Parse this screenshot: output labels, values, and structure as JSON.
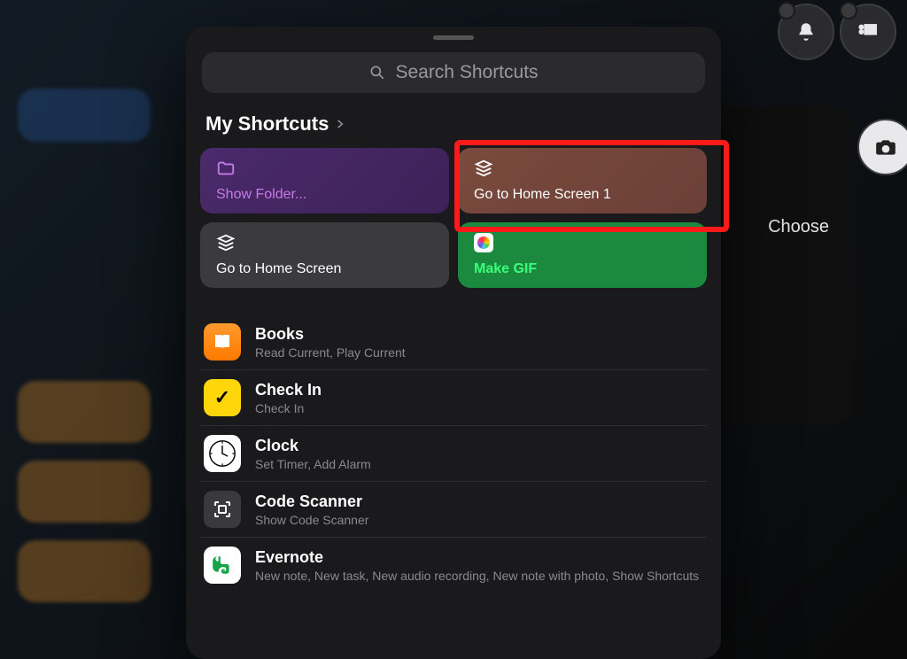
{
  "back_card": {
    "choose_label": "Choose"
  },
  "bubbles": {
    "bell": "bell-icon",
    "list": "list-icon",
    "camera": "camera-icon"
  },
  "search": {
    "placeholder": "Search Shortcuts"
  },
  "section": {
    "title": "My Shortcuts"
  },
  "shortcuts": [
    {
      "id": "show-folder",
      "label": "Show Folder...",
      "color": "purple",
      "icon": "folder-icon"
    },
    {
      "id": "home-screen-1",
      "label": "Go to Home Screen 1",
      "color": "brown",
      "icon": "stack-icon",
      "highlighted": true
    },
    {
      "id": "home-screen",
      "label": "Go to Home Screen",
      "color": "gray",
      "icon": "stack-icon"
    },
    {
      "id": "make-gif",
      "label": "Make GIF",
      "color": "green",
      "icon": "photos-icon"
    }
  ],
  "apps": [
    {
      "id": "books",
      "title": "Books",
      "subtitle": "Read Current, Play Current",
      "icon": "books"
    },
    {
      "id": "checkin",
      "title": "Check In",
      "subtitle": "Check In",
      "icon": "checkin"
    },
    {
      "id": "clock",
      "title": "Clock",
      "subtitle": "Set Timer, Add Alarm",
      "icon": "clock"
    },
    {
      "id": "scanner",
      "title": "Code Scanner",
      "subtitle": "Show Code Scanner",
      "icon": "scanner"
    },
    {
      "id": "evernote",
      "title": "Evernote",
      "subtitle": "New note, New task, New audio recording, New note with photo, Show Shortcuts",
      "icon": "evernote"
    }
  ]
}
